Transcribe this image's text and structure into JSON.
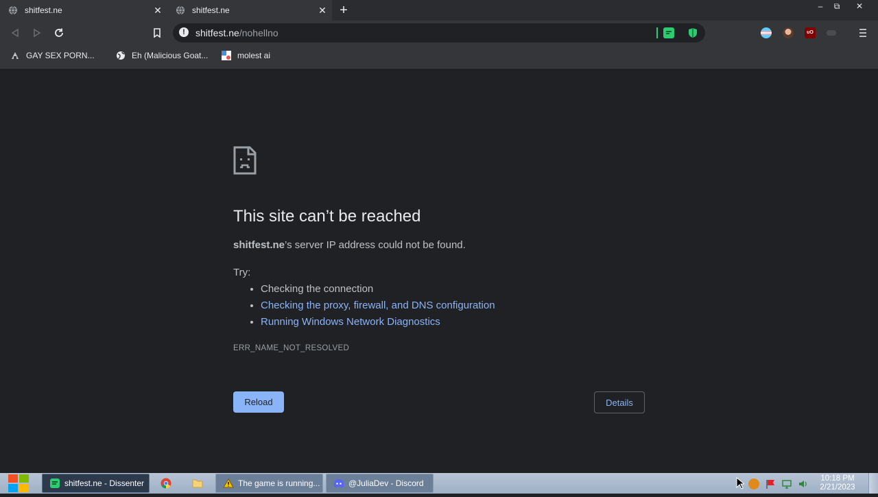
{
  "tabs": [
    {
      "title": "shitfest.ne",
      "icon": "globe-icon"
    },
    {
      "title": "shitfest.ne",
      "icon": "globe-icon"
    }
  ],
  "window_controls": {
    "minimize": "–",
    "restore": "⧉",
    "close": "✕"
  },
  "toolbar": {
    "url_host": "shitfest.ne",
    "url_path": "/nohellno",
    "extensions": [
      "trans-flag-icon",
      "avatar-icon",
      "ublock-icon",
      "disabled-extension-icon"
    ]
  },
  "bookmarks": [
    {
      "label": "GAY SEX PORN...",
      "icon": "bookmark-site-icon"
    },
    {
      "label": "Eh (Malicious Goat...",
      "icon": "globe-icon"
    },
    {
      "label": "molest ai",
      "icon": "bookmark-site-icon"
    }
  ],
  "error": {
    "title": "This site can’t be reached",
    "host": "shitfest.ne",
    "message_rest": "’s server IP address could not be found.",
    "try_label": "Try:",
    "suggestions": [
      {
        "text": "Checking the connection",
        "link": false
      },
      {
        "text": "Checking the proxy, firewall, and DNS configuration",
        "link": true
      },
      {
        "text": "Running Windows Network Diagnostics",
        "link": true
      }
    ],
    "code": "ERR_NAME_NOT_RESOLVED",
    "reload_label": "Reload",
    "details_label": "Details"
  },
  "taskbar": {
    "items": [
      {
        "label": "shitfest.ne - Dissenter",
        "icon": "dissenter-icon",
        "active": true
      },
      {
        "label": "",
        "icon": "chrome-icon"
      },
      {
        "label": "",
        "icon": "folder-icon"
      },
      {
        "label": "The game is running...",
        "icon": "warning-icon"
      },
      {
        "label": "@JuliaDev - Discord",
        "icon": "discord-icon"
      }
    ],
    "clock_time": "10:18 PM",
    "clock_date": "2/21/2023"
  },
  "colors": {
    "page_bg": "#202124",
    "link": "#8ab4f8",
    "reload_bg": "#8ab4f8",
    "dissenter_green": "#2ecc71"
  }
}
